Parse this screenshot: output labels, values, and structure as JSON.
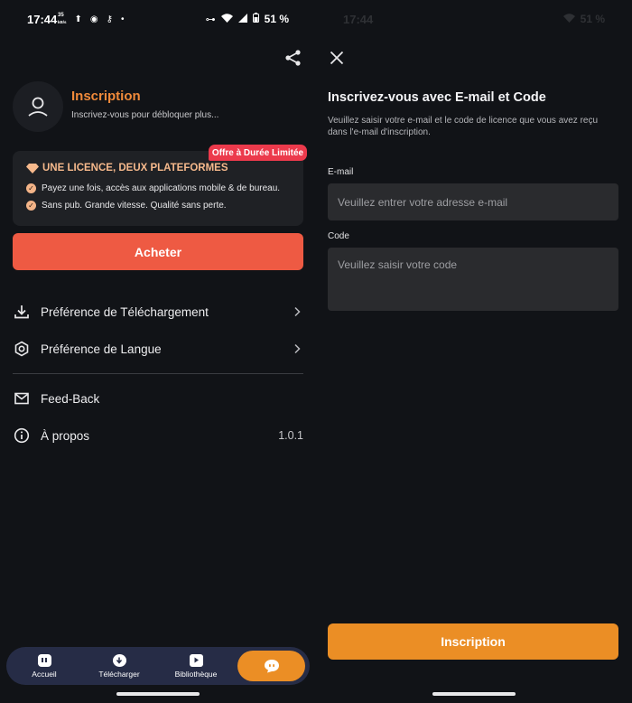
{
  "status_bar": {
    "time": "17:44",
    "net_speed": "35",
    "net_unit": "kB/s",
    "battery": "51 %"
  },
  "profile": {
    "title": "Inscription",
    "subtitle": "Inscrivez-vous pour débloquer plus..."
  },
  "license_card": {
    "badge": "Offre à Durée Limitée",
    "title": "UNE LICENCE, DEUX PLATEFORMES",
    "features": [
      "Payez une fois, accès aux applications mobile & de bureau.",
      "Sans pub. Grande vitesse. Qualité sans perte."
    ]
  },
  "buy_button": "Acheter",
  "menu": {
    "download_pref": "Préférence de Téléchargement",
    "language_pref": "Préférence de Langue",
    "feedback": "Feed-Back",
    "about": "À propos",
    "version": "1.0.1"
  },
  "bottom_nav": {
    "items": [
      "Accueil",
      "Télécharger",
      "Bibliothèque"
    ]
  },
  "signup_form": {
    "title": "Inscrivez-vous avec E-mail et Code",
    "description": "Veuillez saisir votre e-mail et le code de licence que vous avez reçu dans l'e-mail d'inscription.",
    "email_label": "E-mail",
    "email_placeholder": "Veuillez entrer votre adresse e-mail",
    "code_label": "Code",
    "code_placeholder": "Veuillez saisir votre code",
    "submit": "Inscription"
  },
  "colors": {
    "accent_orange": "#eb8e25",
    "buy_red": "#ee5a43",
    "badge_pink": "#ec3a4c",
    "title_orange": "#f08a3a",
    "background": "#111317"
  }
}
